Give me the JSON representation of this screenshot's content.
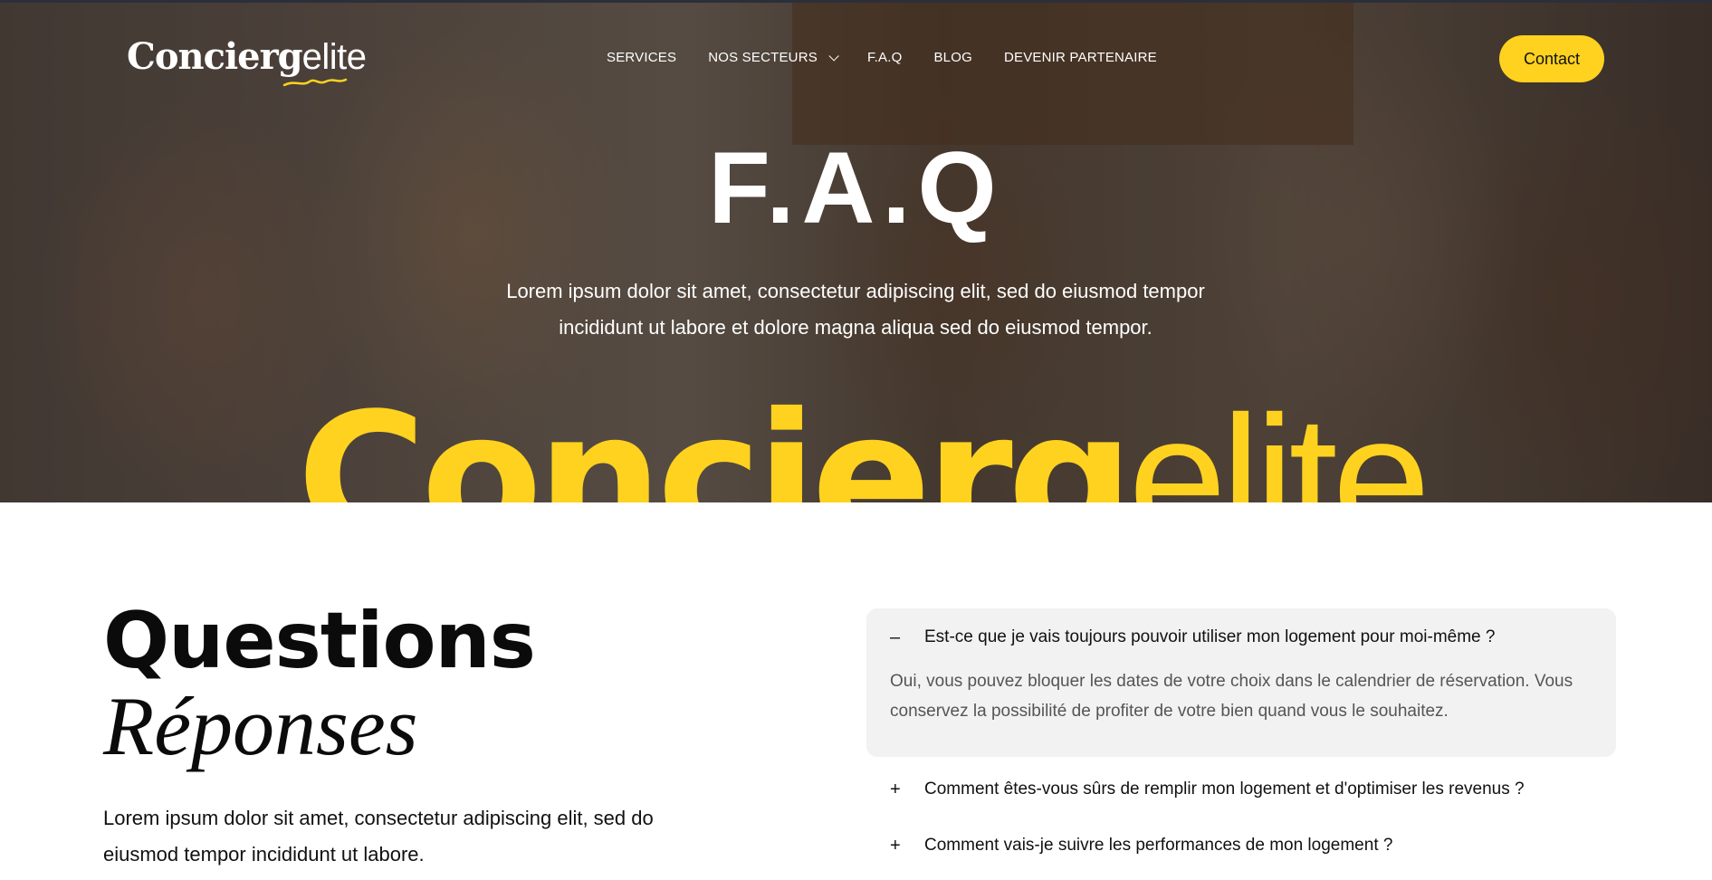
{
  "header": {
    "logo": {
      "part1": "Concierg",
      "part2": "elite"
    },
    "nav": [
      {
        "label": "SERVICES"
      },
      {
        "label": "NOS SECTEURS",
        "dropdown": true
      },
      {
        "label": "F.A.Q"
      },
      {
        "label": "BLOG"
      },
      {
        "label": "DEVENIR PARTENAIRE"
      }
    ],
    "contact_label": "Contact"
  },
  "hero": {
    "title": "F.A.Q",
    "subtitle_line1": "Lorem ipsum dolor sit amet, consectetur adipiscing elit, sed do eiusmod tempor",
    "subtitle_line2": "incididunt ut labore et dolore magna aliqua sed do eiusmod tempor.",
    "big_word_part1": "Concierg",
    "big_word_part2": "elite"
  },
  "section": {
    "title": "Questions",
    "subtitle": "Réponses",
    "description_line1": "Lorem ipsum dolor sit amet, consectetur adipiscing elit, sed do",
    "description_line2": "eiusmod tempor incididunt ut labore."
  },
  "faq": [
    {
      "question": "Est-ce que je vais toujours pouvoir utiliser mon logement pour moi-même ?",
      "answer_line1": "Oui, vous pouvez bloquer les dates de votre choix dans le calendrier de réservation. Vous",
      "answer_line2": "conservez la possibilité de profiter de votre bien quand vous le souhaitez.",
      "open": true,
      "sign": "–"
    },
    {
      "question": "Comment êtes-vous sûrs de remplir mon logement et d'optimiser les revenus ?",
      "open": false,
      "sign": "+"
    },
    {
      "question": "Comment vais-je suivre les performances de mon logement ?",
      "open": false,
      "sign": "+"
    }
  ],
  "colors": {
    "accent": "#ffd21f",
    "faq_open_bg": "#f2f2f2"
  }
}
